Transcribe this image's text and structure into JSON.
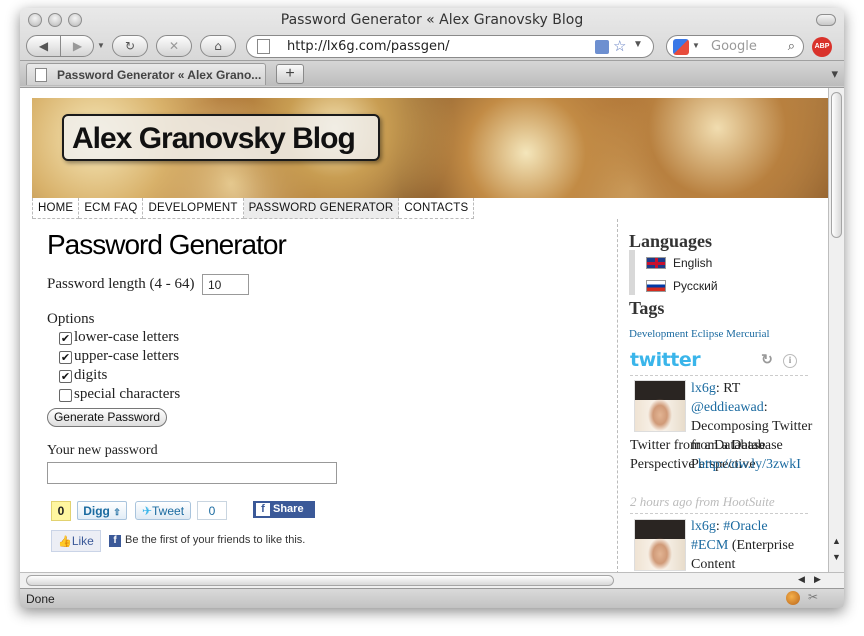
{
  "window": {
    "title": "Password Generator « Alex Granovsky Blog"
  },
  "toolbar": {
    "url": "http://lx6g.com/passgen/",
    "search_placeholder": "Google",
    "icons": [
      "back-icon",
      "forward-icon",
      "reload-icon",
      "stop-icon",
      "home-icon",
      "rss-icon",
      "bookmark-star-icon",
      "adblock-icon"
    ]
  },
  "tabs": [
    {
      "label": "Password Generator « Alex Grano..."
    }
  ],
  "newtab_label": "+",
  "status": {
    "text": "Done"
  },
  "blog": {
    "logo": "Alex Granovsky Blog",
    "nav": [
      "HOME",
      "ECM FAQ",
      "DEVELOPMENT",
      "PASSWORD GENERATOR",
      "CONTACTS"
    ],
    "active_nav": "PASSWORD GENERATOR"
  },
  "form": {
    "title": "Password Generator",
    "length_label": "Password length (4 - 64)",
    "length_value": "10",
    "options_label": "Options",
    "options": [
      {
        "label": "lower-case letters",
        "checked": true
      },
      {
        "label": "upper-case letters",
        "checked": true
      },
      {
        "label": "digits",
        "checked": true
      },
      {
        "label": "special characters",
        "checked": false
      }
    ],
    "generate_button": "Generate Password",
    "new_password_label": "Your new password",
    "new_password_value": ""
  },
  "social": {
    "digg_count": "0",
    "digg_label": "Digg",
    "tweet_label": "Tweet",
    "tweet_count": "0",
    "share_label": "Share",
    "like_label": "Like",
    "like_text": "Be the first of your friends to like this."
  },
  "sidebar": {
    "languages_title": "Languages",
    "languages": [
      {
        "label": "English"
      },
      {
        "label": "Русский"
      }
    ],
    "tags_title": "Tags",
    "tags": [
      "Development",
      "Eclipse",
      "Mercurial"
    ],
    "twitter_logo": "twitter",
    "tweets": [
      {
        "user": "lx6g",
        "prefix": ": RT ",
        "mention": "@eddieawad",
        "text": ": Decomposing Twitter from a Database Perspective ",
        "link": "http://ow.ly/3zwkI",
        "meta": "2 hours ago from HootSuite"
      },
      {
        "user": "lx6g",
        "prefix": ": ",
        "tag1": "#Oracle",
        "tag2": "#ECM",
        "text": " (Enterprise Content"
      }
    ]
  },
  "colors": {
    "link": "#1a6aa0",
    "twitter": "#3ab5ea",
    "facebook": "#3b5998"
  }
}
